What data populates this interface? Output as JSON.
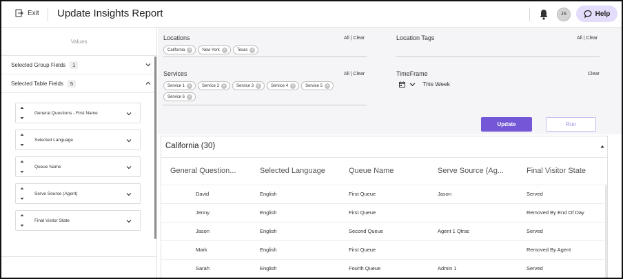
{
  "header": {
    "exit_label": "Exit",
    "title": "Update Insights Report",
    "avatar_initials": "JS",
    "help_label": "Help"
  },
  "left_panel": {
    "values_label": "Values",
    "group_fields_label": "Selected Group Fields",
    "group_fields_count": "1",
    "table_fields_label": "Selected Table Fields",
    "table_fields_count": "5",
    "fields": [
      "General Questions - First Name",
      "Selected Language",
      "Queue Name",
      "Serve Source (Agent)",
      "Final Visitor State"
    ]
  },
  "filters": {
    "locations": {
      "label": "Locations",
      "all_clear": "All | Clear",
      "chips": [
        "California",
        "New York",
        "Texas"
      ]
    },
    "location_tags": {
      "label": "Location Tags",
      "all_clear": "All | Clear"
    },
    "services": {
      "label": "Services",
      "all_clear": "All | Clear",
      "chips": [
        "Service 1",
        "Service 2",
        "Service 3",
        "Service 4",
        "Service 5",
        "Service 6"
      ]
    },
    "timeframe": {
      "label": "TimeFrame",
      "clear": "Clear",
      "value": "This Week"
    }
  },
  "actions": {
    "update_label": "Update",
    "run_label": "Run"
  },
  "results": {
    "group_title": "California (30)",
    "columns": [
      "General Question...",
      "Selected Language",
      "Queue Name",
      "Serve Source (Ag...",
      "Final Visitor State"
    ],
    "rows": [
      [
        "David",
        "English",
        "First Queue",
        "Jason",
        "Served"
      ],
      [
        "Jenny",
        "English",
        "First Queue",
        "",
        "Removed By End Of Day"
      ],
      [
        "Jason",
        "English",
        "Second Queue",
        "Agent 1 Qtrac",
        "Served"
      ],
      [
        "Mark",
        "English",
        "First Queue",
        "",
        "Removed By Agent"
      ],
      [
        "Sarah",
        "English",
        "Fourth Queue",
        "Admin 1",
        "Served"
      ]
    ]
  },
  "colors": {
    "accent": "#7457d6",
    "help_bg": "#e4dcfb",
    "filter_bg": "#f5f5f8"
  }
}
